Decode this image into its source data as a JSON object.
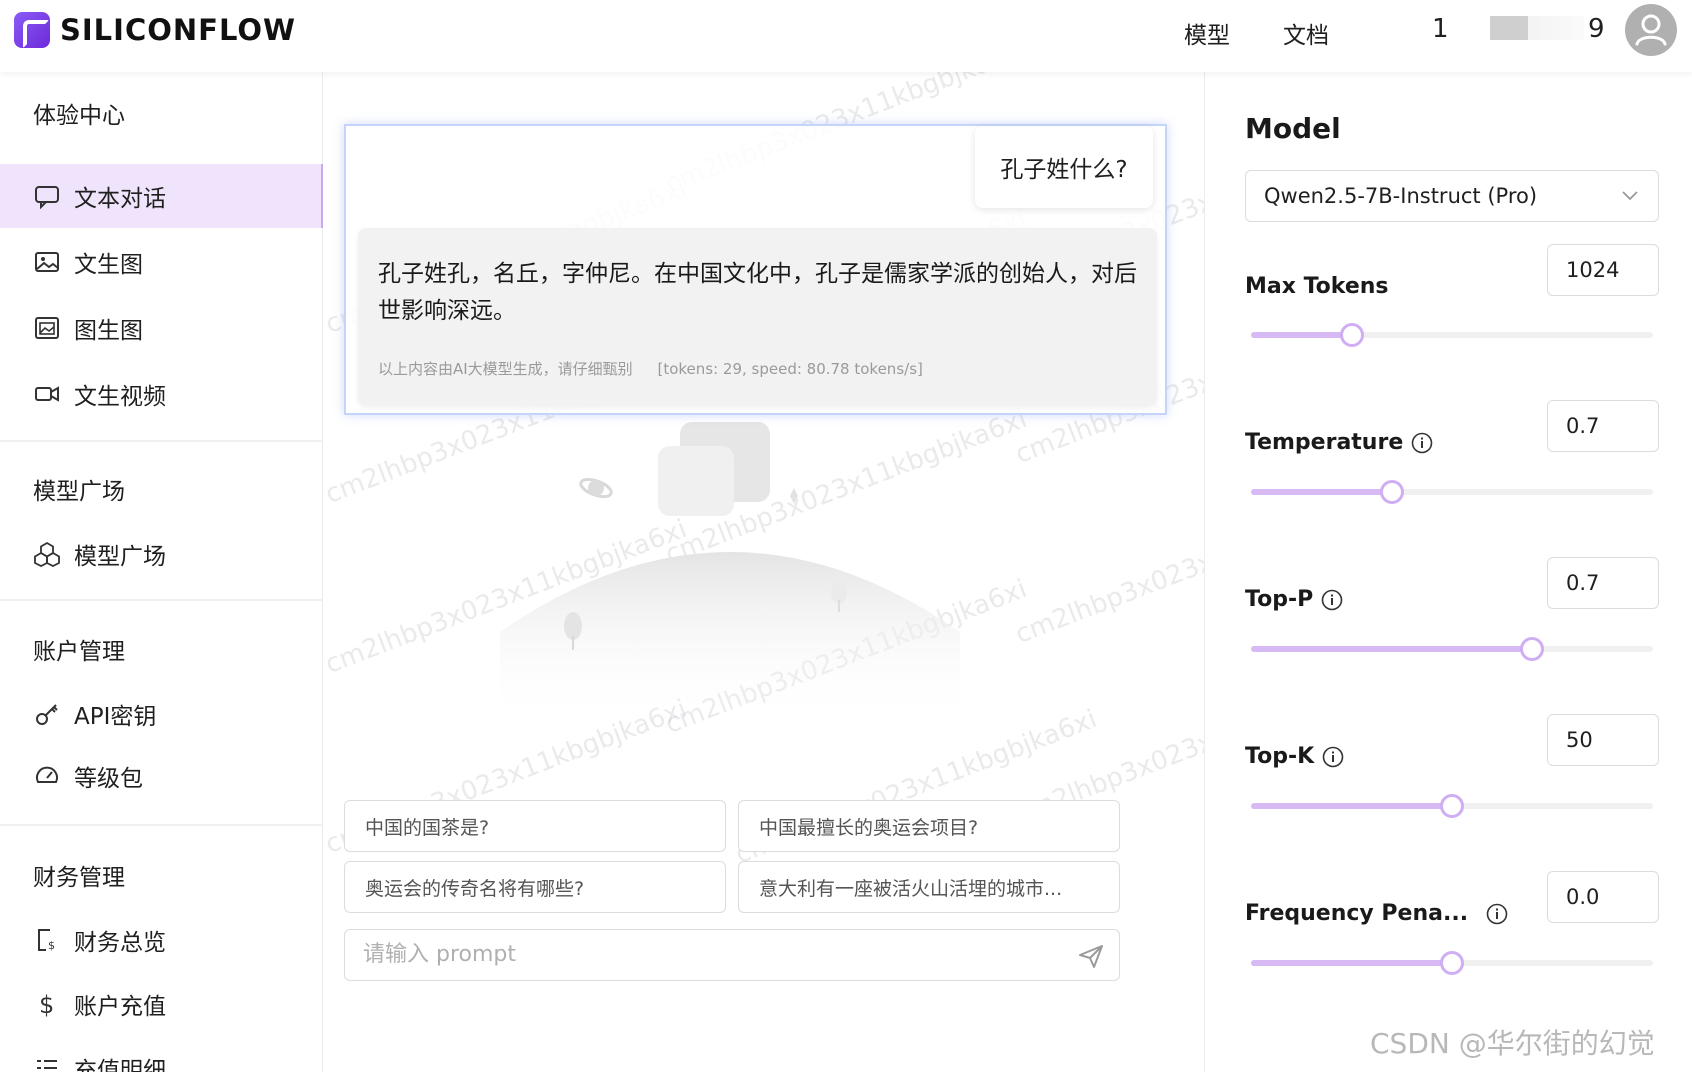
{
  "header": {
    "brand": "SILICONFLOW",
    "nav": [
      "模型",
      "文档"
    ],
    "num_a": "1",
    "num_b": "9"
  },
  "sidebar": {
    "sections": [
      {
        "title": "体验中心",
        "items": [
          "文本对话",
          "文生图",
          "图生图",
          "文生视频"
        ]
      },
      {
        "title": "模型广场",
        "items": [
          "模型广场"
        ]
      },
      {
        "title": "账户管理",
        "items": [
          "API密钥",
          "等级包"
        ]
      },
      {
        "title": "财务管理",
        "items": [
          "财务总览",
          "账户充值",
          "充值明细"
        ]
      }
    ],
    "active_item": "文本对话"
  },
  "chat": {
    "user_message": "孔子姓什么?",
    "ai_message": "孔子姓孔，名丘，字仲尼。在中国文化中，孔子是儒家学派的创始人，对后世影响深远。",
    "ai_disclaimer": "以上内容由AI大模型生成，请仔细甄别",
    "ai_stats": "[tokens: 29, speed: 80.78 tokens/s]",
    "watermark": "cm2lhbp3x023x11kbgbjka6xi",
    "suggestions": [
      "中国的国茶是?",
      "中国最擅长的奥运会项目?",
      "奥运会的传奇名将有哪些?",
      "意大利有一座被活火山活埋的城市..."
    ],
    "input_placeholder": "请输入 prompt"
  },
  "panel": {
    "title": "Model",
    "model_selected": "Qwen2.5-7B-Instruct (Pro)",
    "params": [
      {
        "label": "Max Tokens",
        "value": "1024",
        "fraction": 0.25,
        "info": false
      },
      {
        "label": "Temperature",
        "value": "0.7",
        "fraction": 0.35,
        "info": true
      },
      {
        "label": "Top-P",
        "value": "0.7",
        "fraction": 0.7,
        "info": true
      },
      {
        "label": "Top-K",
        "value": "50",
        "fraction": 0.5,
        "info": true
      },
      {
        "label": "Frequency Pena...",
        "value": "0.0",
        "fraction": 0.5,
        "info": true
      }
    ]
  },
  "footer_watermark": "CSDN @华尔街的幻觉",
  "colors": {
    "accent": "#d7b9f4",
    "active_bg": "#efe4fb",
    "brand": "#7c3aed"
  }
}
